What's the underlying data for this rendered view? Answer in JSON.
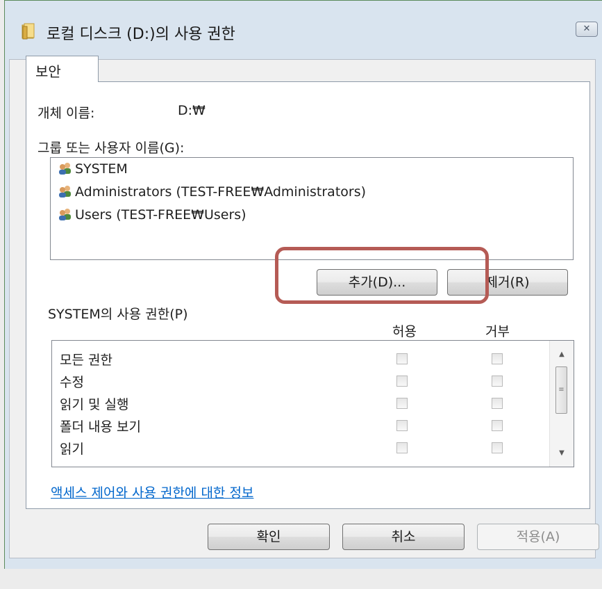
{
  "window": {
    "title": "로컬 디스크 (D:)의 사용 권한",
    "close_glyph": "✕"
  },
  "tabs": [
    {
      "label": "보안"
    }
  ],
  "object": {
    "label": "개체 이름:",
    "value": "D:₩"
  },
  "groups": {
    "label": "그룹 또는 사용자 이름(G):",
    "items": [
      {
        "name": "SYSTEM",
        "icon": "users-icon"
      },
      {
        "name": "Administrators (TEST-FREE₩Administrators)",
        "icon": "users-icon"
      },
      {
        "name": "Users (TEST-FREE₩Users)",
        "icon": "users-icon"
      }
    ],
    "add_label": "추가(D)...",
    "remove_label": "제거(R)"
  },
  "permissions": {
    "label": "SYSTEM의 사용 권한(P)",
    "allow_header": "허용",
    "deny_header": "거부",
    "rows": [
      {
        "name": "모든 권한",
        "allow": false,
        "deny": false
      },
      {
        "name": "수정",
        "allow": false,
        "deny": false
      },
      {
        "name": "읽기 및 실행",
        "allow": false,
        "deny": false
      },
      {
        "name": "폴더 내용 보기",
        "allow": false,
        "deny": false
      },
      {
        "name": "읽기",
        "allow": false,
        "deny": false
      }
    ]
  },
  "link": {
    "label": "액세스 제어와 사용 권한에 대한 정보"
  },
  "footer": {
    "ok_label": "확인",
    "cancel_label": "취소",
    "apply_label": "적용(A)"
  },
  "colors": {
    "link": "#0066cc",
    "highlight": "#b55b55",
    "title_bar": "#d9e4ef"
  }
}
